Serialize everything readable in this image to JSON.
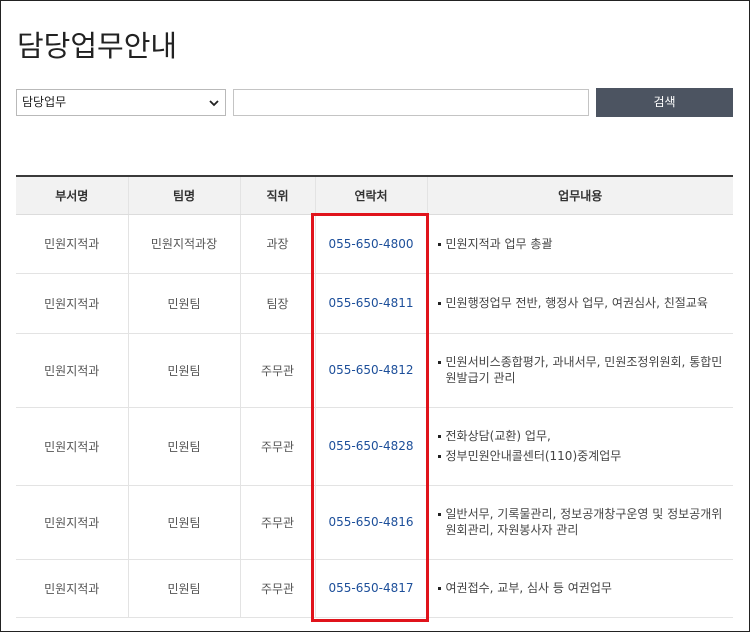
{
  "page": {
    "title": "담당업무안내"
  },
  "search": {
    "select_value": "담당업무",
    "input_value": "",
    "button_label": "검색",
    "select_icon": "chevron-down-icon"
  },
  "table": {
    "headers": [
      "부서명",
      "팀명",
      "직위",
      "연락처",
      "업무내용"
    ],
    "rows": [
      {
        "dept": "민원지적과",
        "team": "민원지적과장",
        "position": "과장",
        "tel": "055-650-4800",
        "duty": [
          "민원지적과 업무 총괄"
        ]
      },
      {
        "dept": "민원지적과",
        "team": "민원팀",
        "position": "팀장",
        "tel": "055-650-4811",
        "duty": [
          "민원행정업무 전반, 행정사 업무, 여권심사, 친절교육"
        ]
      },
      {
        "dept": "민원지적과",
        "team": "민원팀",
        "position": "주무관",
        "tel": "055-650-4812",
        "duty": [
          "민원서비스종합평가, 과내서무, 민원조정위원회, 통합민원발급기 관리"
        ]
      },
      {
        "dept": "민원지적과",
        "team": "민원팀",
        "position": "주무관",
        "tel": "055-650-4828",
        "duty": [
          "전화상담(교환) 업무,",
          "정부민원안내콜센터(110)중계업무"
        ]
      },
      {
        "dept": "민원지적과",
        "team": "민원팀",
        "position": "주무관",
        "tel": "055-650-4816",
        "duty": [
          "일반서무, 기록물관리, 정보공개창구운영 및 정보공개위원회관리, 자원봉사자 관리"
        ]
      },
      {
        "dept": "민원지적과",
        "team": "민원팀",
        "position": "주무관",
        "tel": "055-650-4817",
        "duty": [
          "여권접수, 교부, 심사 등 여권업무"
        ]
      }
    ]
  },
  "colors": {
    "highlight": "#e0131b",
    "button": "#4c5461",
    "tel_link": "#1d4f9a"
  }
}
